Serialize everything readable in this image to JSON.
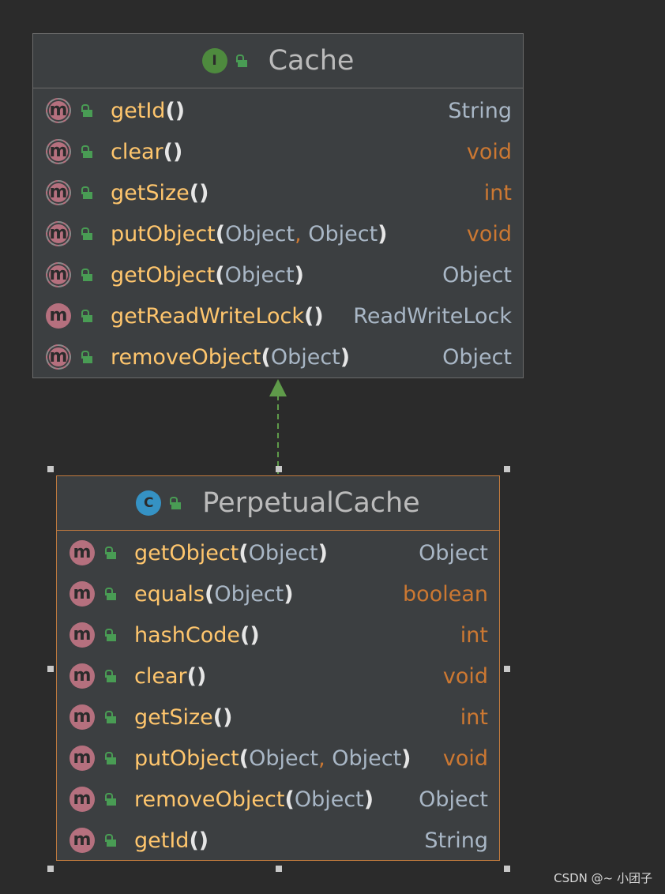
{
  "interface_class": {
    "badge": "I",
    "name": "Cache",
    "methods": [
      {
        "name": "getId",
        "params": "",
        "return_type": "String"
      },
      {
        "name": "clear",
        "params": "",
        "return_type": "void"
      },
      {
        "name": "getSize",
        "params": "",
        "return_type": "int"
      },
      {
        "name": "putObject",
        "params": "Object, Object",
        "return_type": "void"
      },
      {
        "name": "getObject",
        "params": "Object",
        "return_type": "Object"
      },
      {
        "name": "getReadWriteLock",
        "params": "",
        "return_type": "ReadWriteLock"
      },
      {
        "name": "removeObject",
        "params": "Object",
        "return_type": "Object"
      }
    ]
  },
  "implementing_class": {
    "badge": "C",
    "name": "PerpetualCache",
    "methods": [
      {
        "name": "getObject",
        "params": "Object",
        "return_type": "Object"
      },
      {
        "name": "equals",
        "params": "Object",
        "return_type": "boolean"
      },
      {
        "name": "hashCode",
        "params": "",
        "return_type": "int"
      },
      {
        "name": "clear",
        "params": "",
        "return_type": "void"
      },
      {
        "name": "getSize",
        "params": "",
        "return_type": "int"
      },
      {
        "name": "putObject",
        "params": "Object, Object",
        "return_type": "void"
      },
      {
        "name": "removeObject",
        "params": "Object",
        "return_type": "Object"
      },
      {
        "name": "getId",
        "params": "",
        "return_type": "String"
      }
    ]
  },
  "icons": {
    "interface": "interface-icon",
    "class": "class-icon",
    "method": "method-icon",
    "visibility": "public-lock-icon"
  },
  "colors": {
    "background": "#2b2b2b",
    "box": "#3c3f41",
    "method_name": "#ffc66d",
    "primitive_type": "#cc7832",
    "reference_type": "#a9b7c6",
    "interface_badge": "#4e8a3e",
    "class_badge": "#3592c4",
    "selected_border": "#c07a3e",
    "relation_arrow": "#5f9b4a"
  },
  "watermark": "CSDN @~ 小团子"
}
